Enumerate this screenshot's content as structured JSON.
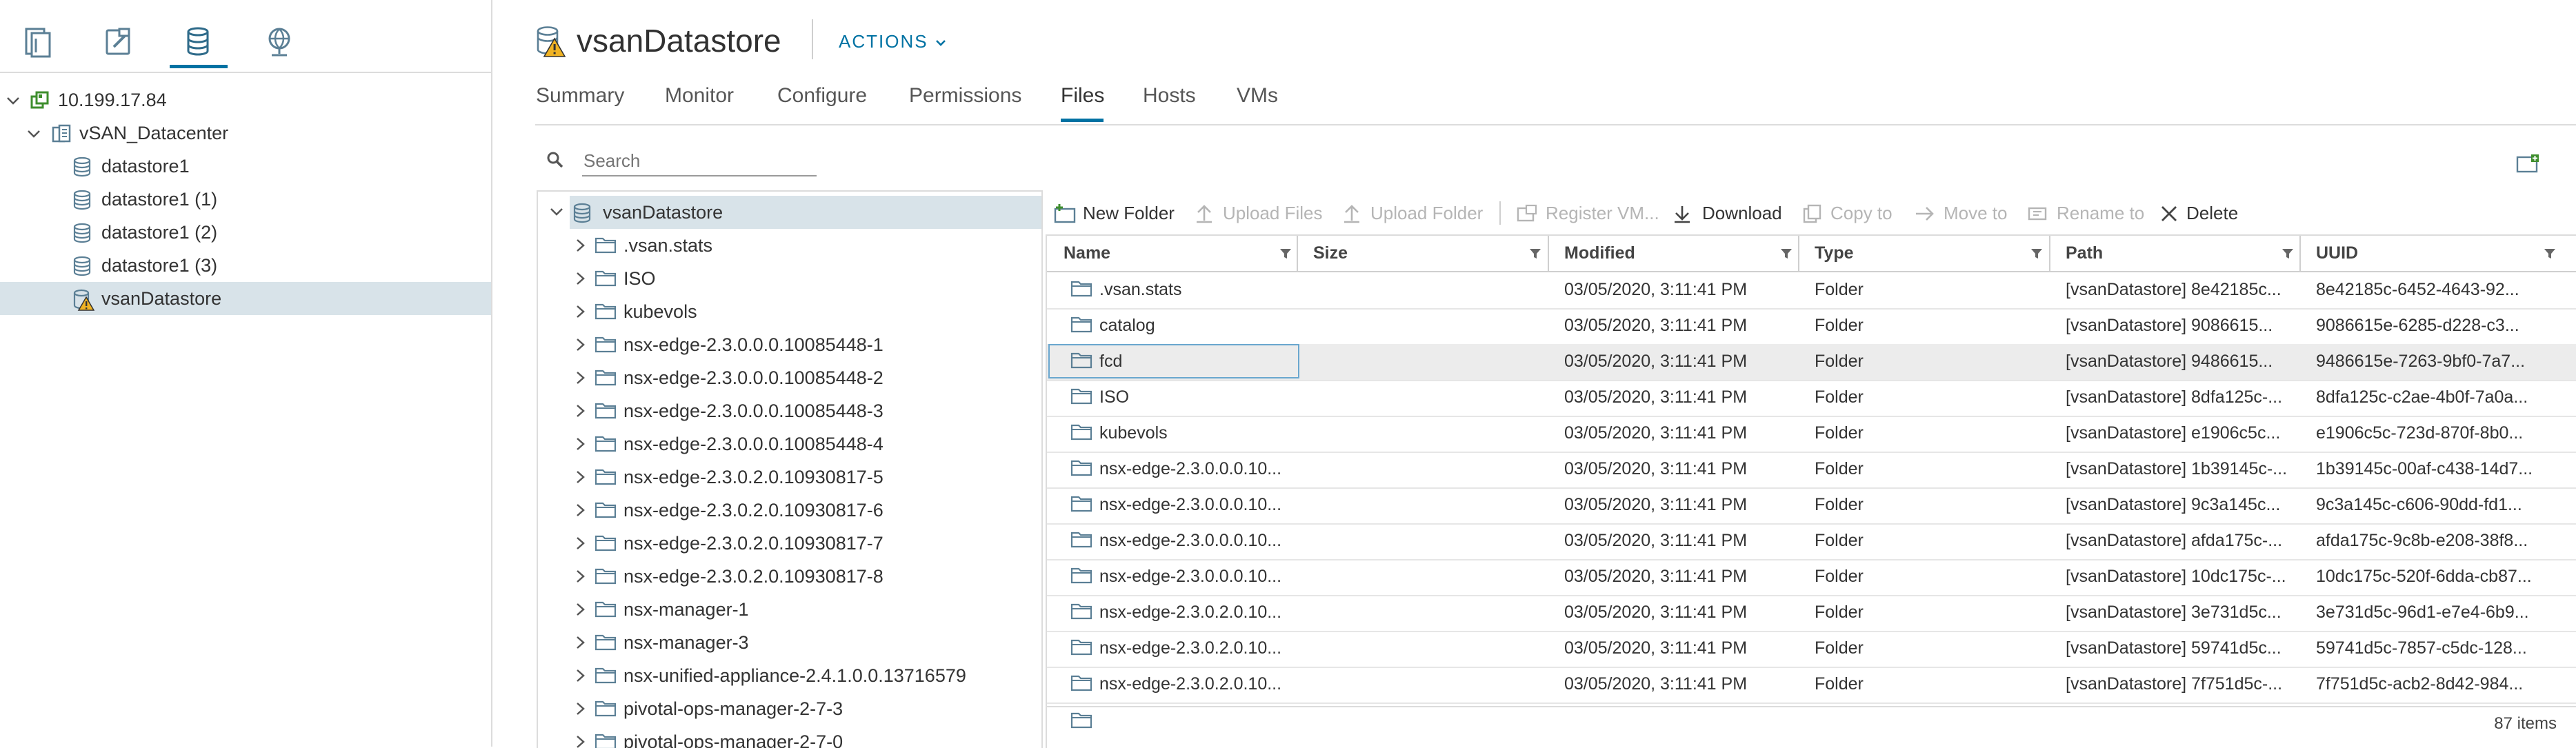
{
  "nav_icons": [
    "hosts-clusters-icon",
    "vms-templates-icon",
    "storage-icon",
    "networking-icon"
  ],
  "inventory": [
    {
      "label": "10.199.17.84",
      "icon": "vcenter-icon"
    },
    {
      "label": "vSAN_Datacenter",
      "icon": "datacenter-icon"
    },
    {
      "label": "datastore1",
      "icon": "datastore-icon"
    },
    {
      "label": "datastore1 (1)",
      "icon": "datastore-icon"
    },
    {
      "label": "datastore1 (2)",
      "icon": "datastore-icon"
    },
    {
      "label": "datastore1 (3)",
      "icon": "datastore-icon"
    },
    {
      "label": "vsanDatastore",
      "icon": "datastore-warning-icon"
    }
  ],
  "header": {
    "title": "vsanDatastore",
    "actions_label": "ACTIONS"
  },
  "tabs": [
    "Summary",
    "Monitor",
    "Configure",
    "Permissions",
    "Files",
    "Hosts",
    "VMs"
  ],
  "active_tab": "Files",
  "search": {
    "placeholder": "Search"
  },
  "file_tree": {
    "root": "vsanDatastore",
    "items": [
      ".vsan.stats",
      "ISO",
      "kubevols",
      "nsx-edge-2.3.0.0.0.10085448-1",
      "nsx-edge-2.3.0.0.0.10085448-2",
      "nsx-edge-2.3.0.0.0.10085448-3",
      "nsx-edge-2.3.0.0.0.10085448-4",
      "nsx-edge-2.3.0.2.0.10930817-5",
      "nsx-edge-2.3.0.2.0.10930817-6",
      "nsx-edge-2.3.0.2.0.10930817-7",
      "nsx-edge-2.3.0.2.0.10930817-8",
      "nsx-manager-1",
      "nsx-manager-3",
      "nsx-unified-appliance-2.4.1.0.0.13716579",
      "pivotal-ops-manager-2-7-3",
      "pivotal-ops-manager-2-7-0"
    ]
  },
  "toolbar": {
    "new_folder": "New Folder",
    "upload_files": "Upload Files",
    "upload_folder": "Upload Folder",
    "register_vm": "Register VM...",
    "download": "Download",
    "copy_to": "Copy to",
    "move_to": "Move to",
    "rename_to": "Rename to",
    "delete": "Delete"
  },
  "grid": {
    "columns": [
      "Name",
      "Size",
      "Modified",
      "Type",
      "Path",
      "UUID"
    ],
    "rows": [
      {
        "name": ".vsan.stats",
        "size": "",
        "modified": "03/05/2020, 3:11:41 PM",
        "type": "Folder",
        "path": "[vsanDatastore] 8e42185c...",
        "uuid": "8e42185c-6452-4643-92..."
      },
      {
        "name": "catalog",
        "size": "",
        "modified": "03/05/2020, 3:11:41 PM",
        "type": "Folder",
        "path": "[vsanDatastore] 9086615...",
        "uuid": "9086615e-6285-d228-c3..."
      },
      {
        "name": "fcd",
        "size": "",
        "modified": "03/05/2020, 3:11:41 PM",
        "type": "Folder",
        "path": "[vsanDatastore] 9486615...",
        "uuid": "9486615e-7263-9bf0-7a7..."
      },
      {
        "name": "ISO",
        "size": "",
        "modified": "03/05/2020, 3:11:41 PM",
        "type": "Folder",
        "path": "[vsanDatastore] 8dfa125c-...",
        "uuid": "8dfa125c-c2ae-4b0f-7a0a..."
      },
      {
        "name": "kubevols",
        "size": "",
        "modified": "03/05/2020, 3:11:41 PM",
        "type": "Folder",
        "path": "[vsanDatastore] e1906c5c...",
        "uuid": "e1906c5c-723d-870f-8b0..."
      },
      {
        "name": "nsx-edge-2.3.0.0.0.10...",
        "size": "",
        "modified": "03/05/2020, 3:11:41 PM",
        "type": "Folder",
        "path": "[vsanDatastore] 1b39145c-...",
        "uuid": "1b39145c-00af-c438-14d7..."
      },
      {
        "name": "nsx-edge-2.3.0.0.0.10...",
        "size": "",
        "modified": "03/05/2020, 3:11:41 PM",
        "type": "Folder",
        "path": "[vsanDatastore] 9c3a145c...",
        "uuid": "9c3a145c-c606-90dd-fd1..."
      },
      {
        "name": "nsx-edge-2.3.0.0.0.10...",
        "size": "",
        "modified": "03/05/2020, 3:11:41 PM",
        "type": "Folder",
        "path": "[vsanDatastore] afda175c-...",
        "uuid": "afda175c-9c8b-e208-38f8..."
      },
      {
        "name": "nsx-edge-2.3.0.0.0.10...",
        "size": "",
        "modified": "03/05/2020, 3:11:41 PM",
        "type": "Folder",
        "path": "[vsanDatastore] 10dc175c-...",
        "uuid": "10dc175c-520f-6dda-cb87..."
      },
      {
        "name": "nsx-edge-2.3.0.2.0.10...",
        "size": "",
        "modified": "03/05/2020, 3:11:41 PM",
        "type": "Folder",
        "path": "[vsanDatastore] 3e731d5c...",
        "uuid": "3e731d5c-96d1-e7e4-6b9..."
      },
      {
        "name": "nsx-edge-2.3.0.2.0.10...",
        "size": "",
        "modified": "03/05/2020, 3:11:41 PM",
        "type": "Folder",
        "path": "[vsanDatastore] 59741d5c...",
        "uuid": "59741d5c-7857-c5dc-128..."
      },
      {
        "name": "nsx-edge-2.3.0.2.0.10...",
        "size": "",
        "modified": "03/05/2020, 3:11:41 PM",
        "type": "Folder",
        "path": "[vsanDatastore] 7f751d5c-...",
        "uuid": "7f751d5c-acb2-8d42-984..."
      }
    ],
    "selected_row": 2,
    "footer": "87 items"
  },
  "colors": {
    "accent": "#0072a3",
    "selected_bg": "#d8e3e9",
    "warning": "#f0b323",
    "border": "#dcdcdc"
  }
}
